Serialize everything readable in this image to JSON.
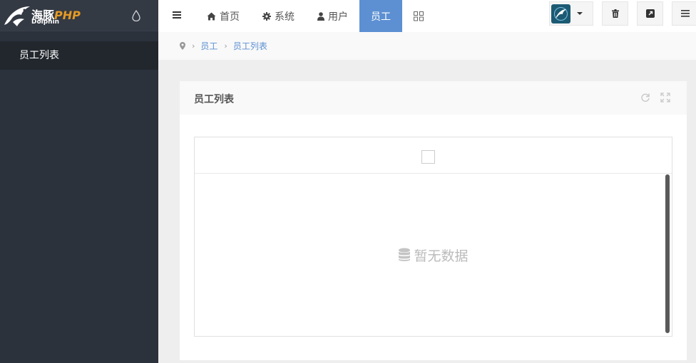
{
  "brand": {
    "name": "海豚",
    "name_suffix": "PHP",
    "subtitle": "Dolphin"
  },
  "sidebar": {
    "items": [
      {
        "label": "员工列表"
      }
    ]
  },
  "topnav": {
    "items": [
      {
        "label": "首页",
        "icon": "home-icon"
      },
      {
        "label": "系统",
        "icon": "gear-icon"
      },
      {
        "label": "用户",
        "icon": "user-icon"
      },
      {
        "label": "员工",
        "icon": ""
      }
    ],
    "active_index": 3
  },
  "breadcrumb": {
    "items": [
      "员工",
      "员工列表"
    ]
  },
  "block": {
    "title": "员工列表",
    "empty_text": "暂无数据"
  },
  "colors": {
    "accent": "#5c90d2",
    "sidebar_bg": "#2c323c",
    "brand_orange": "#e59a23"
  }
}
